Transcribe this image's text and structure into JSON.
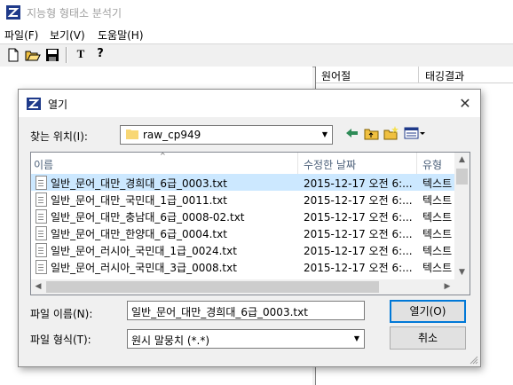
{
  "app": {
    "title": "지능형 형태소 분석기",
    "menu": [
      "파일(F)",
      "보기(V)",
      "도움말(H)"
    ],
    "toolbar": {
      "t_label": "T",
      "help_label": "?"
    },
    "result_columns": [
      "원어절",
      "태깅결과"
    ]
  },
  "dialog": {
    "title": "열기",
    "close_label": "✕",
    "look_in_label": "찾는 위치(I):",
    "look_in_value": "raw_cp949",
    "columns": {
      "name": "이름",
      "date": "수정한 날짜",
      "type": "유형"
    },
    "files": [
      {
        "name": "일반_문어_대만_경희대_6급_0003.txt",
        "date": "2015-12-17 오전 6:...",
        "type": "텍스트"
      },
      {
        "name": "일반_문어_대만_국민대_1급_0011.txt",
        "date": "2015-12-17 오전 6:...",
        "type": "텍스트"
      },
      {
        "name": "일반_문어_대만_충남대_6급_0008-02.txt",
        "date": "2015-12-17 오전 6:...",
        "type": "텍스트"
      },
      {
        "name": "일반_문어_대만_한양대_6급_0004.txt",
        "date": "2015-12-17 오전 6:...",
        "type": "텍스트"
      },
      {
        "name": "일반_문어_러시아_국민대_1급_0024.txt",
        "date": "2015-12-17 오전 6:...",
        "type": "텍스트"
      },
      {
        "name": "일반_문어_러시아_국민대_3급_0008.txt",
        "date": "2015-12-17 오전 6:...",
        "type": "텍스트"
      }
    ],
    "selected_index": 0,
    "file_name_label": "파일 이름(N):",
    "file_name_value": "일반_문어_대만_경희대_6급_0003.txt",
    "file_type_label": "파일 형식(T):",
    "file_type_value": "원시 말뭉치 (*.*)",
    "open_button": "열기(O)",
    "cancel_button": "취소"
  },
  "colors": {
    "selection": "#cce8ff",
    "accent": "#0078d7",
    "folder": "#f8d775"
  }
}
